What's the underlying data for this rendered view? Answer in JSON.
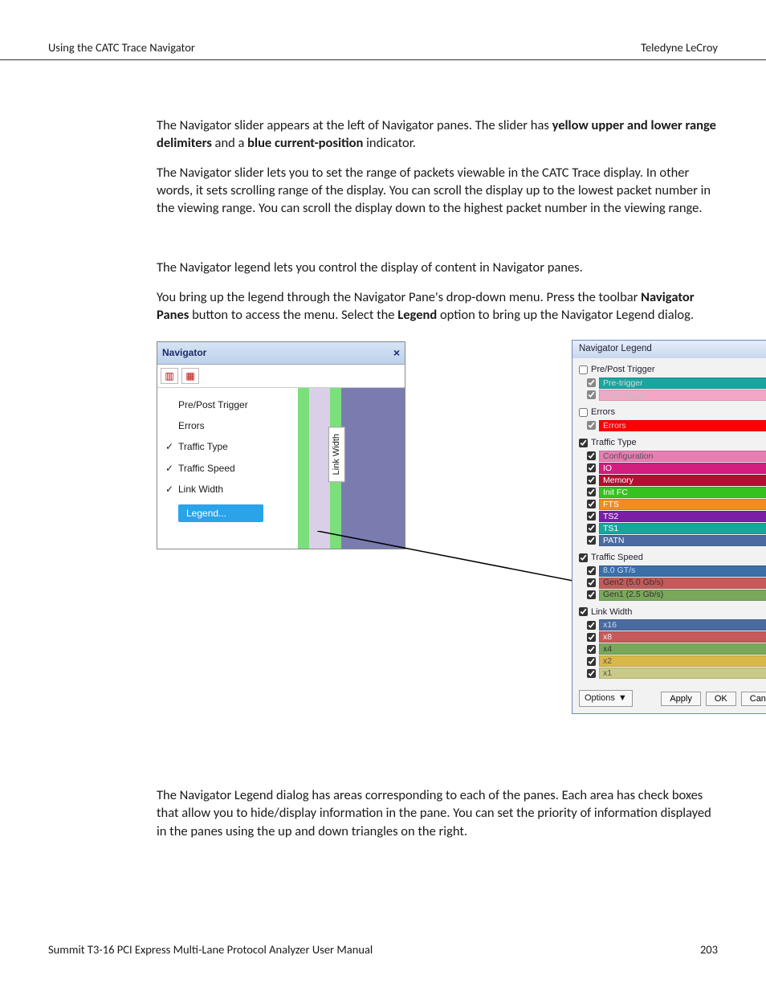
{
  "header": {
    "left": "Using the CATC Trace Navigator",
    "right": "Teledyne LeCroy"
  },
  "para1": {
    "a": "The Navigator slider appears at the left of Navigator panes. The slider has ",
    "b": "yellow upper and lower range delimiters",
    "c": " and a ",
    "d": "blue current-position",
    "e": " indicator."
  },
  "para2": "The Navigator slider lets you to set the range of packets viewable in the CATC Trace display. In other words, it sets scrolling range of the display. You can scroll the display up to the lowest packet number in the viewing range. You can scroll the display down to the highest packet number in the viewing range.",
  "para3": "The Navigator legend lets you control the display of content in Navigator panes.",
  "para4": {
    "a": "You bring up the legend through the Navigator Pane's drop-down menu. Press the toolbar ",
    "b": "Navigator Panes",
    "c": " button to access the menu. Select the ",
    "d": "Legend",
    "e": " option to bring up the Navigator Legend dialog."
  },
  "para5": "The Navigator Legend dialog has areas corresponding to each of the panes. Each area has check boxes that allow you to hide/display information in the pane. You can set the priority of information displayed in the panes using the up and down triangles on the right.",
  "navigator": {
    "title": "Navigator",
    "menu": [
      "Pre/Post Trigger",
      "Errors",
      "Traffic Type",
      "Traffic Speed",
      "Link Width"
    ],
    "checked": [
      false,
      false,
      true,
      true,
      true
    ],
    "legend_item": "Legend...",
    "link_width_label": "Link Width"
  },
  "legend": {
    "title": "Navigator Legend",
    "groups": [
      {
        "name": "Pre/Post Trigger",
        "head_checked": false,
        "items": [
          {
            "label": "Pre-trigger",
            "color": "#1aa5a0",
            "text": "#d8d8d8",
            "disabled": true
          },
          {
            "label": "Post-trigger",
            "color": "#f4a6c6",
            "text": "#c0c0c0",
            "disabled": true
          }
        ]
      },
      {
        "name": "Errors",
        "head_checked": false,
        "items": [
          {
            "label": "Errors",
            "color": "#ff0000",
            "text": "#d8d8d8",
            "disabled": true
          }
        ]
      },
      {
        "name": "Traffic Type",
        "head_checked": true,
        "items": [
          {
            "label": "Configuration",
            "color": "#e57fb3",
            "text": "#555"
          },
          {
            "label": "IO",
            "color": "#d21e7e",
            "text": "#fff"
          },
          {
            "label": "Memory",
            "color": "#b01030",
            "text": "#fff"
          },
          {
            "label": "Init FC",
            "color": "#35c21e",
            "text": "#fff"
          },
          {
            "label": "FTS",
            "color": "#f28c1e",
            "text": "#fff"
          },
          {
            "label": "TS2",
            "color": "#7a1ea8",
            "text": "#fff"
          },
          {
            "label": "TS1",
            "color": "#13a89a",
            "text": "#fff"
          },
          {
            "label": "PATN",
            "color": "#4a6aa0",
            "text": "#fff"
          }
        ]
      },
      {
        "name": "Traffic Speed",
        "head_checked": true,
        "items": [
          {
            "label": "8.0 GT/s",
            "color": "#3a6fa8",
            "text": "#cde"
          },
          {
            "label": "Gen2 (5.0 Gb/s)",
            "color": "#c65a5a",
            "text": "#333"
          },
          {
            "label": "Gen1 (2.5 Gb/s)",
            "color": "#7aa85a",
            "text": "#333"
          }
        ]
      },
      {
        "name": "Link Width",
        "head_checked": true,
        "items": [
          {
            "label": "x16",
            "color": "#4a6aa0",
            "text": "#d0d8e8"
          },
          {
            "label": "x8",
            "color": "#c65a5a",
            "text": "#eee"
          },
          {
            "label": "x4",
            "color": "#7aa85a",
            "text": "#333"
          },
          {
            "label": "x2",
            "color": "#d8b84a",
            "text": "#555"
          },
          {
            "label": "x1",
            "color": "#c9ca85",
            "text": "#555"
          }
        ]
      }
    ],
    "footer": {
      "options": "Options",
      "apply": "Apply",
      "ok": "OK",
      "cancel": "Cancel"
    }
  },
  "footer": {
    "left": "Summit T3-16 PCI Express Multi-Lane Protocol Analyzer User Manual",
    "right": "203"
  }
}
